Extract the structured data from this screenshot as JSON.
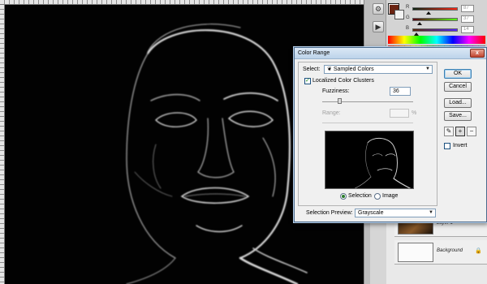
{
  "dialog": {
    "title": "Color Range",
    "close_glyph": "x",
    "select_label": "Select:",
    "select_value": "Sampled Colors",
    "localized_label": "Localized Color Clusters",
    "localized_checked": true,
    "fuzziness_label": "Fuzziness:",
    "fuzziness_value": "36",
    "range_label": "Range:",
    "range_value": "",
    "range_unit": "%",
    "selection_radio": "Selection",
    "image_radio": "Image",
    "preview_label": "Selection Preview:",
    "preview_value": "Grayscale",
    "buttons": {
      "ok": "OK",
      "cancel": "Cancel",
      "load": "Load...",
      "save": "Save..."
    },
    "invert_label": "Invert",
    "invert_checked": false,
    "eyedropper_tools": [
      "eyedropper-icon",
      "eyedropper-plus-icon",
      "eyedropper-minus-icon"
    ]
  },
  "color_panel": {
    "channels": [
      {
        "letter": "R",
        "value": "87"
      },
      {
        "letter": "G",
        "value": "37"
      },
      {
        "letter": "B",
        "value": "14"
      }
    ],
    "foreground_color": "#6b2412",
    "background_color": "#f2f2f2"
  },
  "layers": [
    {
      "name": "Layer 1"
    },
    {
      "name": "Background"
    }
  ],
  "icons": {
    "dock": [
      "history-icon",
      "actions-icon"
    ],
    "lock": "lock-icon"
  }
}
